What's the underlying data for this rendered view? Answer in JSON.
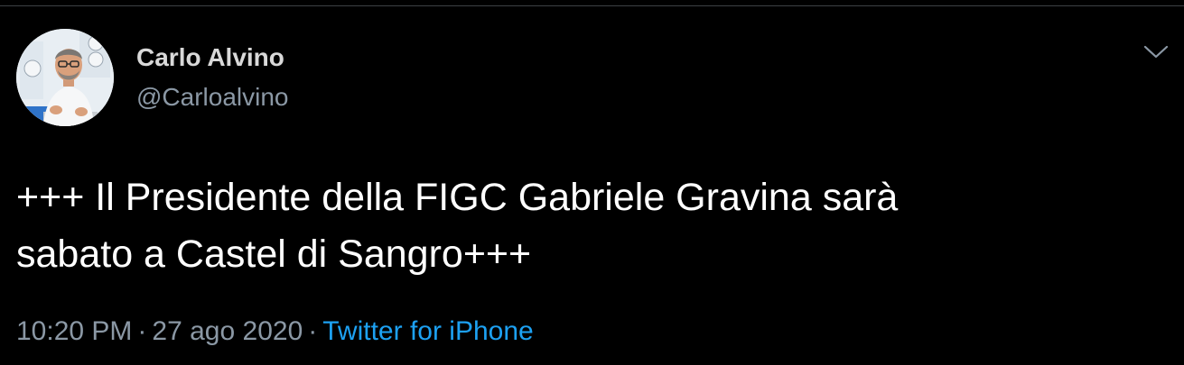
{
  "tweet": {
    "author_name": "Carlo Alvino",
    "author_handle": "@Carloalvino",
    "text_line1": "+++ Il Presidente della FIGC Gabriele Gravina sarà",
    "text_line2": "sabato a Castel di Sangro+++",
    "time": "10:20 PM",
    "date": "27 ago 2020",
    "separator": "·",
    "source": "Twitter for iPhone"
  },
  "icons": {
    "menu": "chevron-down-icon",
    "avatar": "profile-photo"
  },
  "colors": {
    "background": "#000000",
    "primary_text": "#ffffff",
    "secondary_text": "#8b98a5",
    "link": "#1da1f2",
    "border": "#3d4145"
  }
}
